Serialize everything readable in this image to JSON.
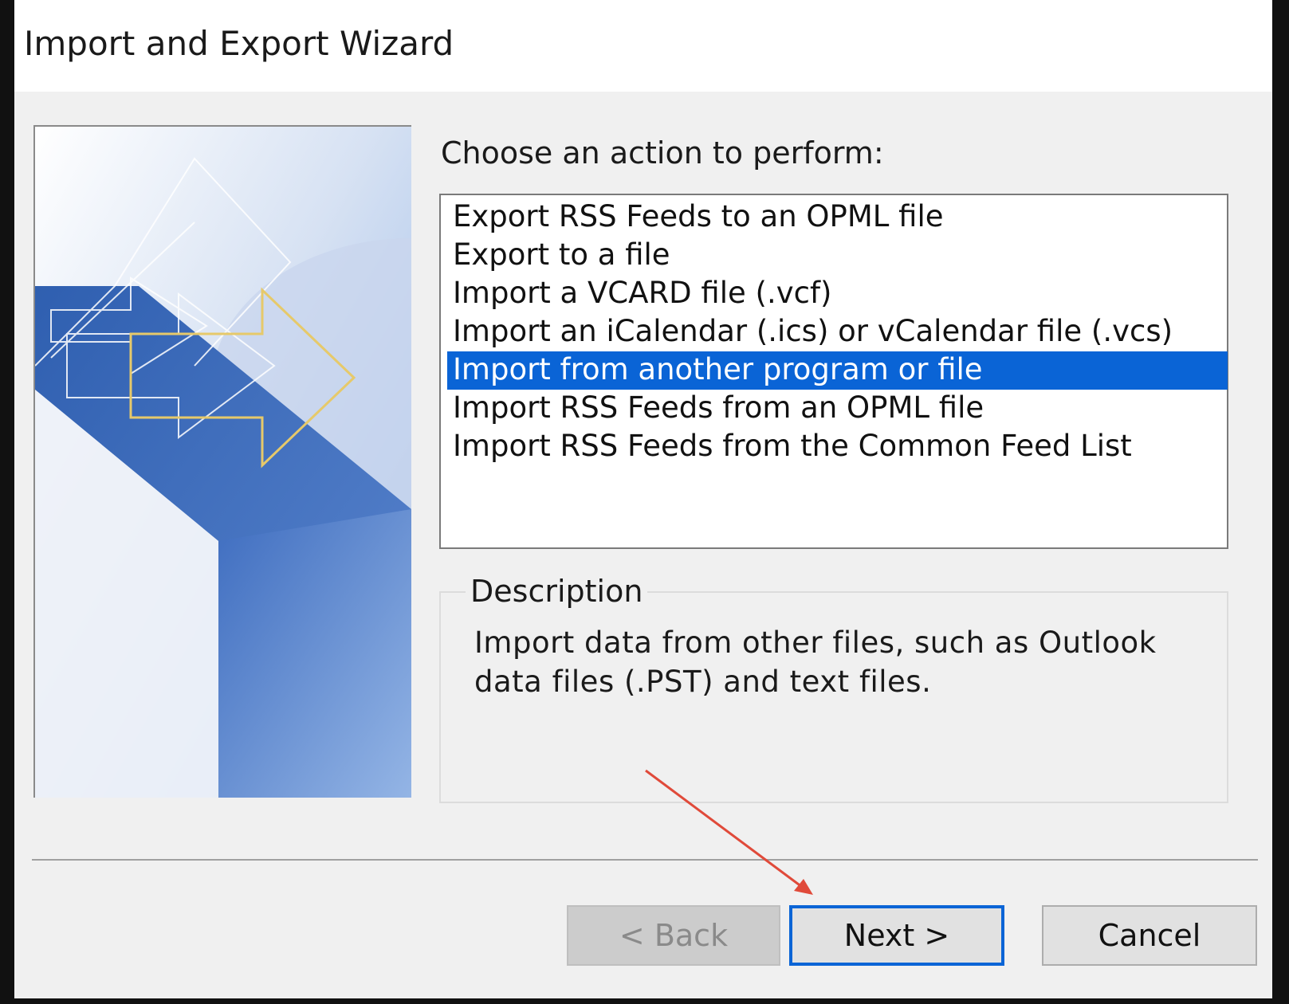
{
  "window": {
    "title": "Import and Export Wizard"
  },
  "prompt": "Choose an action to perform:",
  "actions": [
    {
      "label": "Export RSS Feeds to an OPML file",
      "selected": false
    },
    {
      "label": "Export to a file",
      "selected": false
    },
    {
      "label": "Import a VCARD file (.vcf)",
      "selected": false
    },
    {
      "label": "Import an iCalendar (.ics) or vCalendar file (.vcs)",
      "selected": false
    },
    {
      "label": "Import from another program or file",
      "selected": true
    },
    {
      "label": "Import RSS Feeds from an OPML file",
      "selected": false
    },
    {
      "label": "Import RSS Feeds from the Common Feed List",
      "selected": false
    }
  ],
  "description": {
    "label": "Description",
    "text": "Import data from other files, such as Outlook data files (.PST) and text files."
  },
  "buttons": {
    "back": {
      "label": "< Back",
      "enabled": false
    },
    "next": {
      "label": "Next >",
      "enabled": true,
      "focused": true
    },
    "cancel": {
      "label": "Cancel",
      "enabled": true
    }
  },
  "colors": {
    "selection": "#0a64d6",
    "annotation_arrow": "#e04a3a",
    "banner_gold": "#e6c96a"
  }
}
